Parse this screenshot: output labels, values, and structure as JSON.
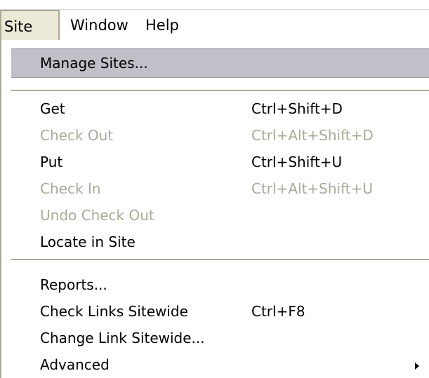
{
  "menubar": {
    "items": [
      {
        "label": "Site"
      },
      {
        "label": "Window"
      },
      {
        "label": "Help"
      }
    ]
  },
  "dropdown": {
    "group1": {
      "manage_sites": {
        "label": "Manage Sites..."
      }
    },
    "group2": {
      "get": {
        "label": "Get",
        "shortcut": "Ctrl+Shift+D",
        "enabled": true
      },
      "check_out": {
        "label": "Check Out",
        "shortcut": "Ctrl+Alt+Shift+D",
        "enabled": false
      },
      "put": {
        "label": "Put",
        "shortcut": "Ctrl+Shift+U",
        "enabled": true
      },
      "check_in": {
        "label": "Check In",
        "shortcut": "Ctrl+Alt+Shift+U",
        "enabled": false
      },
      "undo_check_out": {
        "label": "Undo Check Out",
        "enabled": false
      },
      "locate_in_site": {
        "label": "Locate in Site",
        "enabled": true
      }
    },
    "group3": {
      "reports": {
        "label": "Reports..."
      },
      "check_links_sitewide": {
        "label": "Check Links Sitewide",
        "shortcut": "Ctrl+F8"
      },
      "change_link_sitewide": {
        "label": "Change Link Sitewide..."
      },
      "advanced": {
        "label": "Advanced",
        "has_submenu": true
      }
    }
  },
  "colors": {
    "highlight": "#c1c0c8",
    "disabled_text": "#aca899",
    "menubar_active": "#ece9d8"
  }
}
